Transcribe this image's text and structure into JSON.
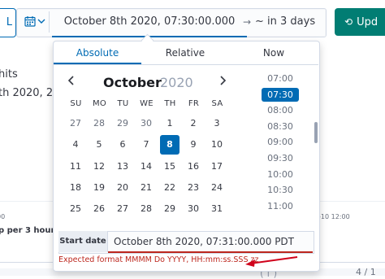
{
  "toolbar": {
    "left_button_fragment": "L",
    "range_start": "October 8th 2020, 07:30:00.000 PDT",
    "arrow": "→",
    "range_end": "~ in 3 days",
    "update_label": "Upd"
  },
  "background": {
    "hits_fragment": "hits",
    "date_fragment": "th 2020, 23",
    "left_tick": "00",
    "per_label_fragment": "p per 3 hours",
    "right_tick_fragment": "-10 12:00",
    "bottom_fragment": "4 / 1",
    "bottom_cut_text": "(  f  )"
  },
  "popover": {
    "tabs": [
      {
        "label": "Absolute",
        "active": true
      },
      {
        "label": "Relative",
        "active": false
      },
      {
        "label": "Now",
        "active": false
      }
    ],
    "calendar": {
      "month": "October",
      "year": "2020",
      "prev": "‹",
      "next": "›",
      "weekdays": [
        "SU",
        "MO",
        "TU",
        "WE",
        "TH",
        "FR",
        "SA"
      ],
      "weeks": [
        [
          {
            "d": "27",
            "m": true
          },
          {
            "d": "28",
            "m": true
          },
          {
            "d": "29",
            "m": true
          },
          {
            "d": "30",
            "m": true
          },
          {
            "d": "1"
          },
          {
            "d": "2"
          },
          {
            "d": "3"
          }
        ],
        [
          {
            "d": "4"
          },
          {
            "d": "5"
          },
          {
            "d": "6"
          },
          {
            "d": "7"
          },
          {
            "d": "8",
            "sel": true
          },
          {
            "d": "9"
          },
          {
            "d": "10"
          }
        ],
        [
          {
            "d": "11"
          },
          {
            "d": "12"
          },
          {
            "d": "13"
          },
          {
            "d": "14"
          },
          {
            "d": "15"
          },
          {
            "d": "16"
          },
          {
            "d": "17"
          }
        ],
        [
          {
            "d": "18"
          },
          {
            "d": "19"
          },
          {
            "d": "20"
          },
          {
            "d": "21"
          },
          {
            "d": "22"
          },
          {
            "d": "23"
          },
          {
            "d": "24"
          }
        ],
        [
          {
            "d": "25"
          },
          {
            "d": "26"
          },
          {
            "d": "27"
          },
          {
            "d": "28"
          },
          {
            "d": "29"
          },
          {
            "d": "30"
          },
          {
            "d": "31"
          }
        ]
      ]
    },
    "times": [
      {
        "t": "07:00"
      },
      {
        "t": "07:30",
        "sel": true
      },
      {
        "t": "08:00"
      },
      {
        "t": "08:30"
      },
      {
        "t": "09:00"
      },
      {
        "t": "09:30"
      },
      {
        "t": "10:00"
      },
      {
        "t": "10:30"
      },
      {
        "t": "11:00"
      }
    ],
    "start": {
      "label": "Start date",
      "value": "October 8th 2020, 07:31:00.000 PDT",
      "error": "Expected format MMMM Do YYYY, HH:mm:ss.SSS zz"
    }
  },
  "colors": {
    "primary": "#006bb4",
    "success": "#017d73",
    "danger": "#bd271e"
  }
}
